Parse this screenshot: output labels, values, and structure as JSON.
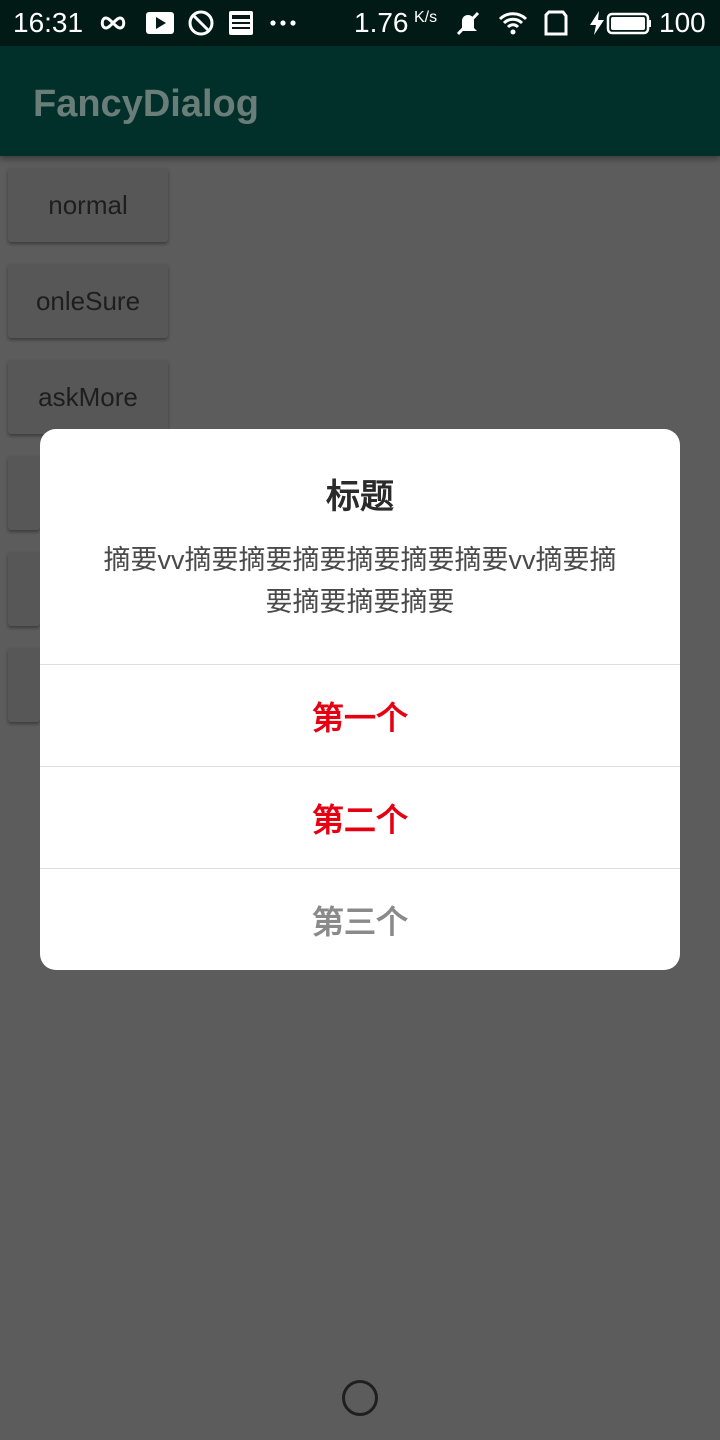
{
  "status_bar": {
    "time": "16:31",
    "net_speed": "1.76",
    "net_speed_unit": "K/s",
    "battery_level": "100",
    "icons": [
      "infinity-icon",
      "play-icon",
      "do-not-disturb-icon",
      "news-icon",
      "more-dots-icon",
      "mute-icon",
      "wifi-icon",
      "sim-icon",
      "charging-icon",
      "battery-icon"
    ]
  },
  "app_bar": {
    "title": "FancyDialog"
  },
  "background_buttons": [
    {
      "label": "normal"
    },
    {
      "label": "onleSure"
    },
    {
      "label": "askMore"
    }
  ],
  "dialog": {
    "title": "标题",
    "message": "摘要vv摘要摘要摘要摘要摘要摘要vv摘要摘要摘要摘要摘要",
    "options": [
      {
        "label": "第一个",
        "color": "#e60012"
      },
      {
        "label": "第二个",
        "color": "#e60012"
      },
      {
        "label": "第三个",
        "color": "#8a8a8a"
      }
    ]
  },
  "colors": {
    "status_bar_bg": "#021a16",
    "app_bar_bg": "#01302a",
    "scrim_bg": "#5c5c5c",
    "accent_red": "#e60012"
  }
}
